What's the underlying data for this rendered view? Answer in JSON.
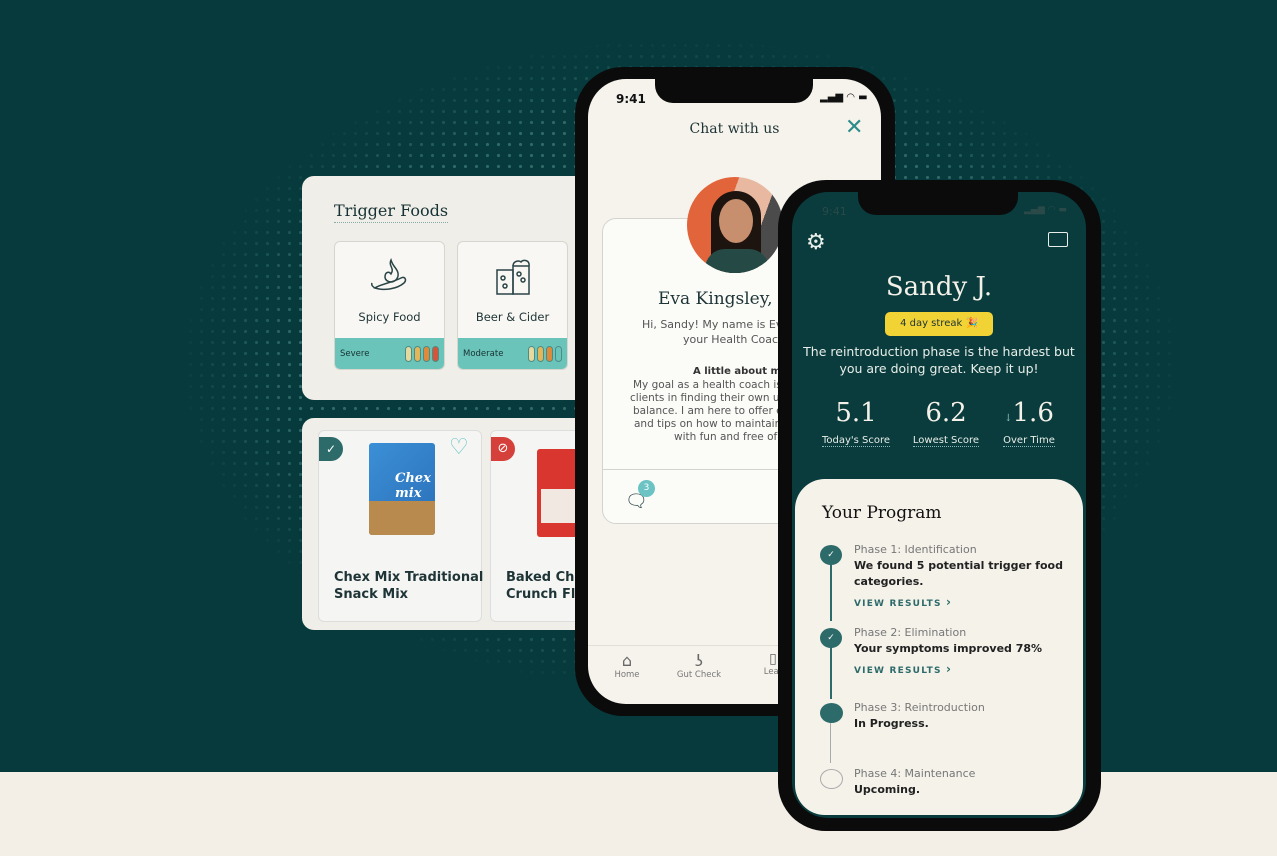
{
  "trigger_foods": {
    "title": "Trigger Foods",
    "items": [
      {
        "name": "Spicy Food",
        "icon": "chili-flame-icon",
        "severity": "Severe",
        "levels": [
          "#e6d9a0",
          "#e3b65a",
          "#df8a3a",
          "#d4553a"
        ]
      },
      {
        "name": "Beer & Cider",
        "icon": "beer-glass-icon",
        "severity": "Moderate",
        "levels": [
          "#e6d9a0",
          "#e3b65a",
          "#df8a3a",
          "none"
        ]
      }
    ]
  },
  "products": [
    {
      "name_line1": "Chex Mix Traditional",
      "name_line2": "Snack Mix",
      "status": "approved",
      "favorite_icon": "heart-icon"
    },
    {
      "name_line1": "Baked Che",
      "name_line2": "Crunch Fla",
      "status": "avoid"
    }
  ],
  "chat_phone": {
    "time": "9:41",
    "title": "Chat with us",
    "coach_name": "Eva Kingsley, R",
    "greeting": [
      "Hi, Sandy! My name is Ev",
      "your Health Coac"
    ],
    "about_heading": "A little about me:",
    "about": [
      "My goal as a health coach is t",
      "clients in finding their own uni",
      "balance. I am here to offer en",
      "and tips on how to maintain yo",
      "with fun and free of ru"
    ],
    "badge_count": "3",
    "nav": [
      "Home",
      "Gut Check",
      "Lear"
    ]
  },
  "home_phone": {
    "time": "9:41",
    "name": "Sandy J.",
    "streak": "4 day streak",
    "message": [
      "The reintroduction phase is the hardest but",
      "you are doing great. Keep it up!"
    ],
    "scores": [
      {
        "value": "5.1",
        "label": "Today's Score"
      },
      {
        "value": "6.2",
        "label": "Lowest Score"
      },
      {
        "value": "1.6",
        "label": "Over Time",
        "trend": "down"
      }
    ],
    "program": {
      "title": "Your Program",
      "phases": [
        {
          "name": "Phase 1: Identification",
          "line1": "We found 5 potential trigger food",
          "line2": "categories.",
          "link": "VIEW RESULTS",
          "state": "done"
        },
        {
          "name": "Phase 2: Elimination",
          "line1": "Your symptoms improved 78%",
          "link": "VIEW RESULTS",
          "state": "done"
        },
        {
          "name": "Phase 3: Reintroduction",
          "line1": "In Progress.",
          "state": "current"
        },
        {
          "name": "Phase 4: Maintenance",
          "line1": "Upcoming.",
          "state": "upcoming"
        }
      ]
    }
  },
  "colors": {
    "bg": "#073a3c",
    "teal": "#2d6b6a",
    "streak": "#f2d335",
    "severity_bar": "#6bc4b9"
  }
}
